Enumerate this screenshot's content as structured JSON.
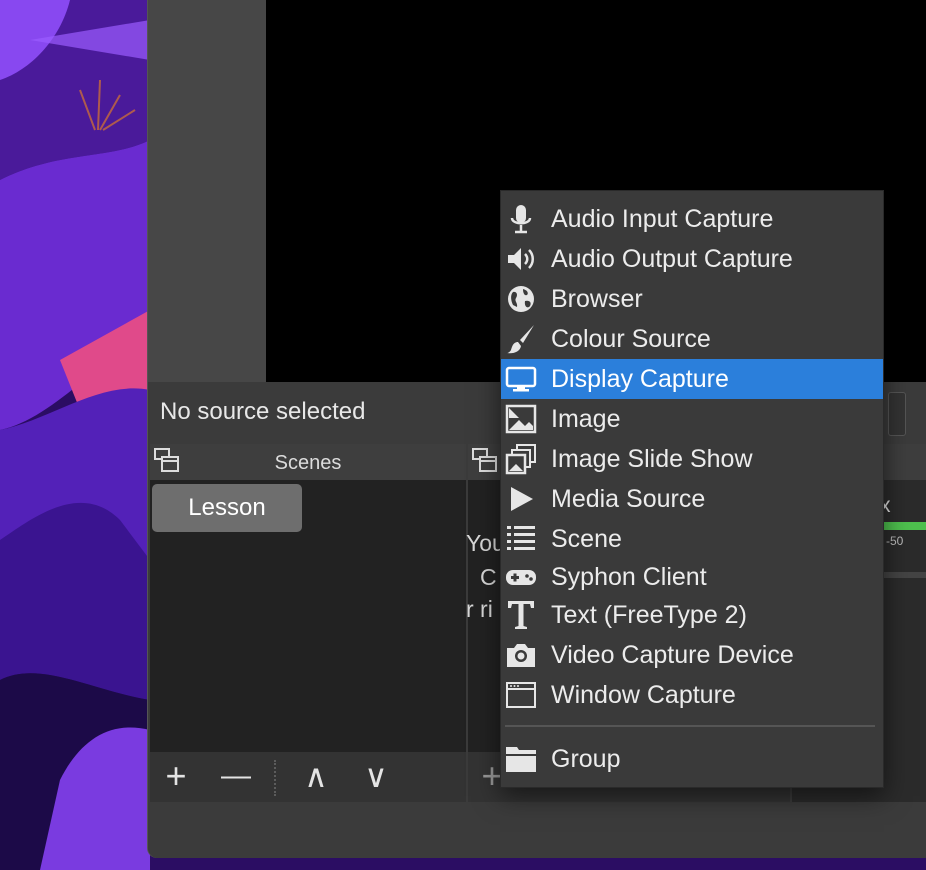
{
  "status": {
    "no_source": "No source selected"
  },
  "scenes": {
    "title": "Scenes",
    "items": [
      {
        "label": "Lesson"
      }
    ],
    "toolbar": {
      "add": "+",
      "remove": "—",
      "up": "∧",
      "down": "∨"
    }
  },
  "sources": {
    "empty_lines": [
      "You",
      "C",
      "r ri"
    ],
    "toolbar": {
      "add": "+"
    }
  },
  "mixer": {
    "label": "x",
    "meter_tick": "-50"
  },
  "menu": {
    "items": [
      {
        "label": "Audio Input Capture",
        "icon": "microphone-icon"
      },
      {
        "label": "Audio Output Capture",
        "icon": "speaker-icon"
      },
      {
        "label": "Browser",
        "icon": "globe-icon"
      },
      {
        "label": "Colour Source",
        "icon": "paintbrush-icon"
      },
      {
        "label": "Display Capture",
        "icon": "monitor-icon",
        "selected": true
      },
      {
        "label": "Image",
        "icon": "image-icon"
      },
      {
        "label": "Image Slide Show",
        "icon": "image-stack-icon"
      },
      {
        "label": "Media Source",
        "icon": "play-icon"
      },
      {
        "label": "Scene",
        "icon": "list-icon"
      },
      {
        "label": "Syphon Client",
        "icon": "gamepad-icon"
      },
      {
        "label": "Text (FreeType 2)",
        "icon": "text-icon"
      },
      {
        "label": "Video Capture Device",
        "icon": "camera-icon"
      },
      {
        "label": "Window Capture",
        "icon": "window-icon"
      }
    ],
    "group": {
      "label": "Group",
      "icon": "folder-icon"
    },
    "selected_color": "#2b7fdb"
  }
}
